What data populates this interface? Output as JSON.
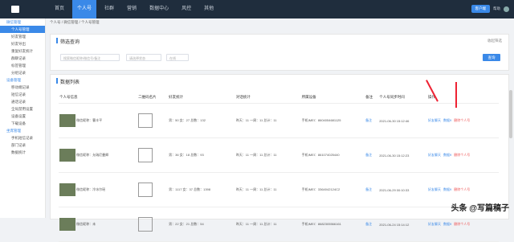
{
  "nav": [
    "首页",
    "个人号",
    "社群",
    "营销",
    "数据中心",
    "风控",
    "其他"
  ],
  "top_right": {
    "download": "客户端",
    "help": "帮助"
  },
  "sidebar": [
    {
      "type": "group",
      "label": "微信管理"
    },
    {
      "type": "item",
      "label": "个人号管理",
      "active": true
    },
    {
      "type": "item",
      "label": "好友管理"
    },
    {
      "type": "item",
      "label": "好友导出"
    },
    {
      "type": "item",
      "label": "重复好友统计"
    },
    {
      "type": "item",
      "label": "群聊记录"
    },
    {
      "type": "item",
      "label": "标签管理"
    },
    {
      "type": "item",
      "label": "分组记录"
    },
    {
      "type": "group",
      "label": "设备管理"
    },
    {
      "type": "item",
      "label": "移动端记录"
    },
    {
      "type": "item",
      "label": "短信记录"
    },
    {
      "type": "item",
      "label": "通话记录"
    },
    {
      "type": "item",
      "label": "全局禁用设置"
    },
    {
      "type": "item",
      "label": "设备设置"
    },
    {
      "type": "item",
      "label": "下载设备"
    },
    {
      "type": "group",
      "label": "坐席管理"
    },
    {
      "type": "item",
      "label": "手机短信记录"
    },
    {
      "type": "item",
      "label": "部门记录"
    },
    {
      "type": "item",
      "label": "数据统计"
    }
  ],
  "breadcrumb": "个人号 / 微信管理 / 个人号管理",
  "filter": {
    "title": "筛选查询",
    "collapse": "收起筛选",
    "placeholder1": "搜索微信昵称/微信号/备注",
    "placeholder2": "请选择状态",
    "placeholder3": "在线",
    "query": "查询"
  },
  "data": {
    "title": "数据列表"
  },
  "columns": [
    "个人号信息",
    "二维码名片",
    "好友统计",
    "对话统计",
    "所属设备",
    "备注",
    "个人号同步时间",
    "操作"
  ],
  "rows": [
    {
      "info": "微信昵称：曹丰平",
      "friends": "男：50 女：27 总数：132",
      "talk": "昨天：11 一周：11 总计：11",
      "device": "手机IMEI：8604054681125",
      "remark": "备注",
      "time": "2021-06-30 15:12:46",
      "ops": [
        "好友聊天",
        "数据9",
        "删除个人号"
      ]
    },
    {
      "info": "微信昵称：允瑞尼曼卿",
      "friends": "男：36 女：18 总数：93",
      "talk": "昨天：11 一周：11 总计：11",
      "device": "手机IMEI：861074025440",
      "remark": "备注",
      "time": "2021-06-30 15:12:23",
      "ops": [
        "好友聊天",
        "数据9",
        "删除个人号"
      ]
    },
    {
      "info": "微信昵称：冷冰尔瑶",
      "friends": "男：1117 女：37 总数：1398",
      "talk": "昨天：11 一周：11 总计：11",
      "device": "手机IMEI：3364042124C2",
      "remark": "备注",
      "time": "2021-06-29 00:10:33",
      "ops": [
        "好友聊天",
        "数据9",
        "删除个人号"
      ]
    },
    {
      "info": "微信昵称：未",
      "friends": "男：22 女：21 总数：54",
      "talk": "昨天：11 一周：11 总计：11",
      "device": "手机IMEI：8682305566161",
      "remark": "备注",
      "time": "2021-06-24 15:14:12",
      "ops": [
        "好友聊天",
        "数据9",
        "删除个人号"
      ]
    }
  ],
  "watermark": "头条 @写篇稿子"
}
